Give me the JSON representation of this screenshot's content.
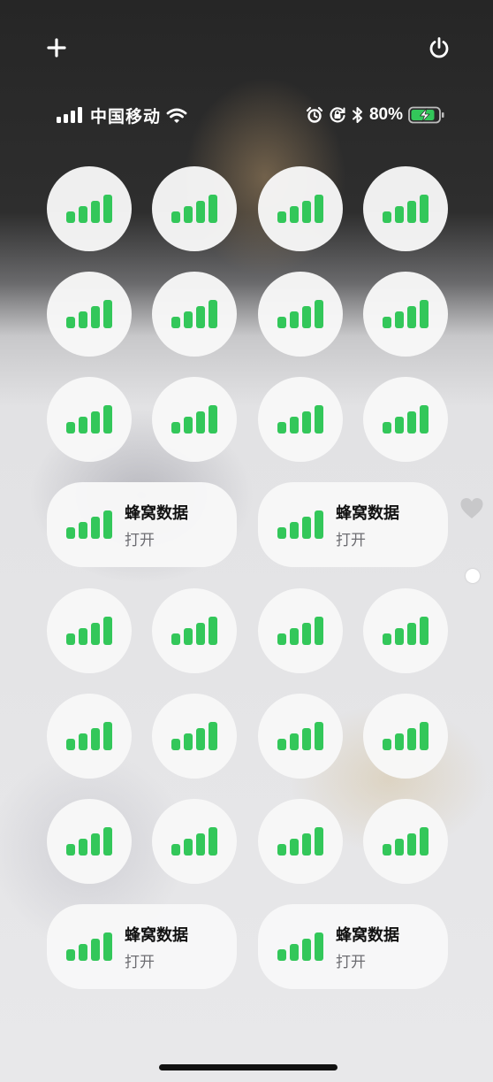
{
  "status_bar": {
    "carrier": "中国移动",
    "battery_percent": "80%",
    "icons": [
      "cellular-signal-icon",
      "wifi-icon",
      "alarm-icon",
      "orientation-lock-icon",
      "bluetooth-icon",
      "battery-charging-icon"
    ]
  },
  "controls": {
    "add_icon": "plus-icon",
    "power_icon": "power-icon"
  },
  "tile": {
    "label": "蜂窝数据",
    "state": "打开",
    "icon": "cellular-signal-icon",
    "accent": "#33c75a"
  },
  "pages": {
    "count": 2,
    "current": 2,
    "first_page_icon": "heart-icon"
  }
}
